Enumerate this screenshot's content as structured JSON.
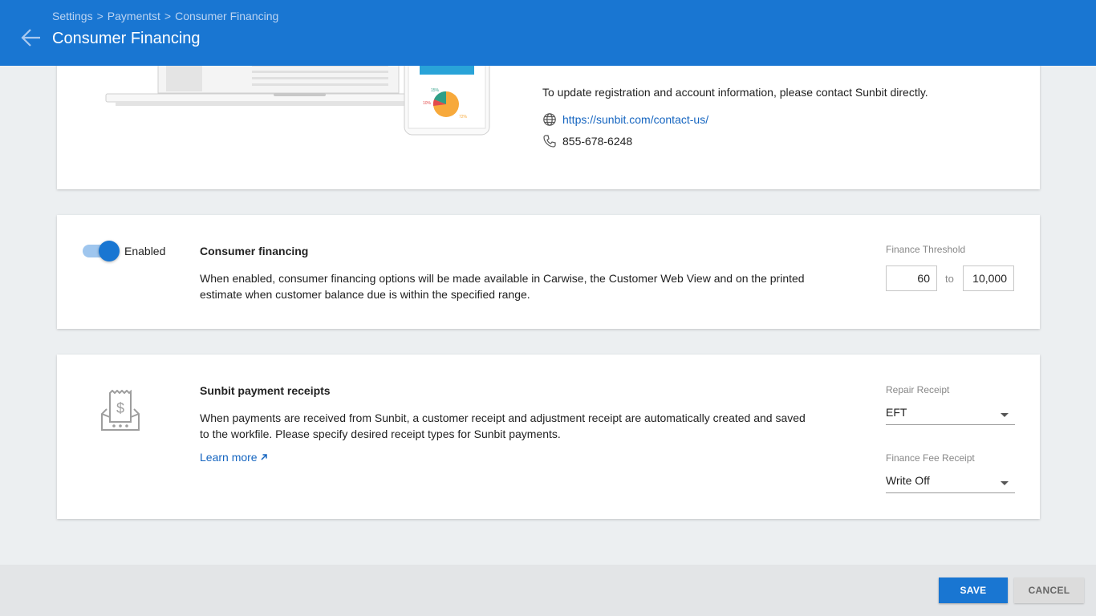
{
  "header": {
    "breadcrumb": [
      "Settings",
      "Paymentst",
      "Consumer Financing"
    ],
    "breadcrumb_separator": ">",
    "title": "Consumer Financing",
    "background_color": "#1976d2"
  },
  "contact": {
    "text": "To update registration and account information, please contact Sunbit directly.",
    "url": "https://sunbit.com/contact-us/",
    "phone": "855-678-6248",
    "url_icon": "globe-icon",
    "phone_icon": "phone-icon"
  },
  "financing": {
    "toggle_label": "Enabled",
    "toggle_on": true,
    "title": "Consumer financing",
    "description": "When enabled, consumer financing options will be made available in Carwise, the Customer Web View and on the printed estimate when customer balance due is within the specified range.",
    "threshold_label": "Finance Threshold",
    "min_value": "60",
    "to_label": "to",
    "max_value": "10,000"
  },
  "receipts": {
    "icon": "receipt-dollar-icon",
    "title": "Sunbit payment receipts",
    "description": "When payments are received from Sunbit, a customer receipt and adjustment receipt are automatically created and saved to the workfile. Please specify desired receipt types for Sunbit payments.",
    "learn_more": "Learn more",
    "repair_receipt_label": "Repair Receipt",
    "repair_receipt_value": "EFT",
    "finance_fee_label": "Finance Fee Receipt",
    "finance_fee_value": "Write Off"
  },
  "footer": {
    "save_label": "SAVE",
    "cancel_label": "CANCEL"
  }
}
